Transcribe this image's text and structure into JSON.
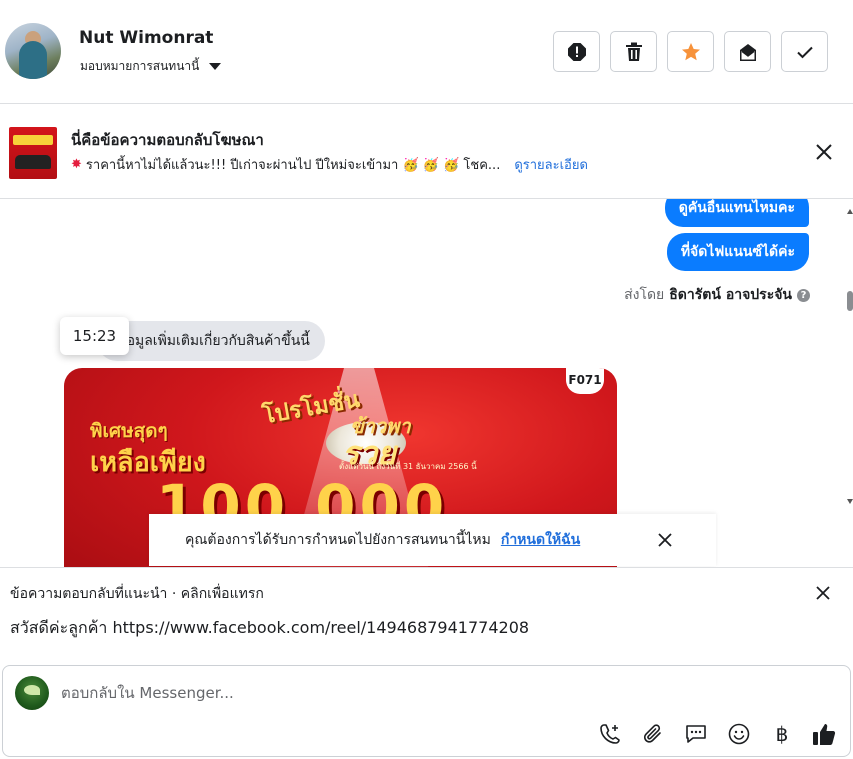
{
  "header": {
    "contact_name": "Nut Wimonrat",
    "assign_label": "มอบหมายการสนทนานี้",
    "buttons": [
      {
        "icon": "alert-icon"
      },
      {
        "icon": "trash-icon"
      },
      {
        "icon": "star-icon",
        "color": "#f7923a"
      },
      {
        "icon": "mark-unread-icon"
      },
      {
        "icon": "check-icon"
      }
    ]
  },
  "ad_banner": {
    "title": "นี่คือข้อความตอบกลับโฆษณา",
    "spark_icon": "✸",
    "description": "ราคานี้หาไม่ได้แล้วนะ!!! ปีเก่าจะผ่านไป ปีใหม่จะเข้ามา 🥳 🥳 🥳 โชค...",
    "details_link": "ดูรายละเอียด"
  },
  "conversation": {
    "outgoing": [
      "ดูคันอื่นแทนไหมคะ",
      "ที่จัดไฟแนนซ์ได้ค่ะ"
    ],
    "sent_by_prefix": "ส่งโดย",
    "sent_by_name": "ธิดารัตน์ อาจประจัน",
    "help_icon": "?",
    "incoming": "ข้อมูลเพิ่มเติมเกี่ยวกับสินค้าขึ้นนี้",
    "timestamp": "15:23",
    "promo": {
      "badge": "F071",
      "special_line1": "พิเศษสุดๆ",
      "special_line2": "เหลือเพียง",
      "title": "โปรโมชั่น",
      "subtitle": "ข้าวพา",
      "slogan": "รวย",
      "date_note": "ตั้งแต่วันนี้ ถึงวันที่ 31 ธันวาคม 2566 นี้",
      "price": "100,000"
    },
    "assign_prompt": {
      "text": "คุณต้องการได้รับการกำหนดไปยังการสนทนานี้ไหม",
      "link": "กำหนดให้ฉัน"
    }
  },
  "suggested_reply": {
    "label": "ข้อความตอบกลับที่แนะนำ · คลิกเพื่อแทรก",
    "text": "สวัสดีค่ะลูกค้า https://www.facebook.com/reel/1494687941774208"
  },
  "composer": {
    "placeholder": "ตอบกลับใน Messenger...",
    "tools": [
      "phone-add-icon",
      "attachment-icon",
      "saved-reply-icon",
      "emoji-icon",
      "baht-icon",
      "like-icon"
    ],
    "baht_symbol": "฿"
  }
}
